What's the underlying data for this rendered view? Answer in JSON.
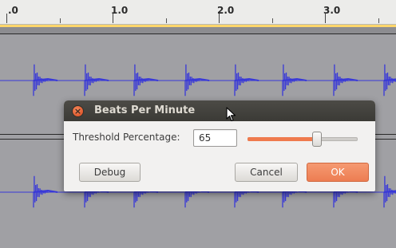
{
  "ruler": {
    "labels": [
      ".0",
      "1.0",
      "2.0",
      "3.0"
    ]
  },
  "dialog": {
    "title": "Beats Per Minute",
    "close_icon": "close-icon",
    "threshold_label": "Threshold Percentage:",
    "threshold_value": "65",
    "slider_value_fraction": 0.63,
    "debug_label": "Debug",
    "cancel_label": "Cancel",
    "ok_label": "OK"
  },
  "colors": {
    "waveform": "#3838d8",
    "accent": "#ef7a4d",
    "track_border": "#fdd66a"
  }
}
